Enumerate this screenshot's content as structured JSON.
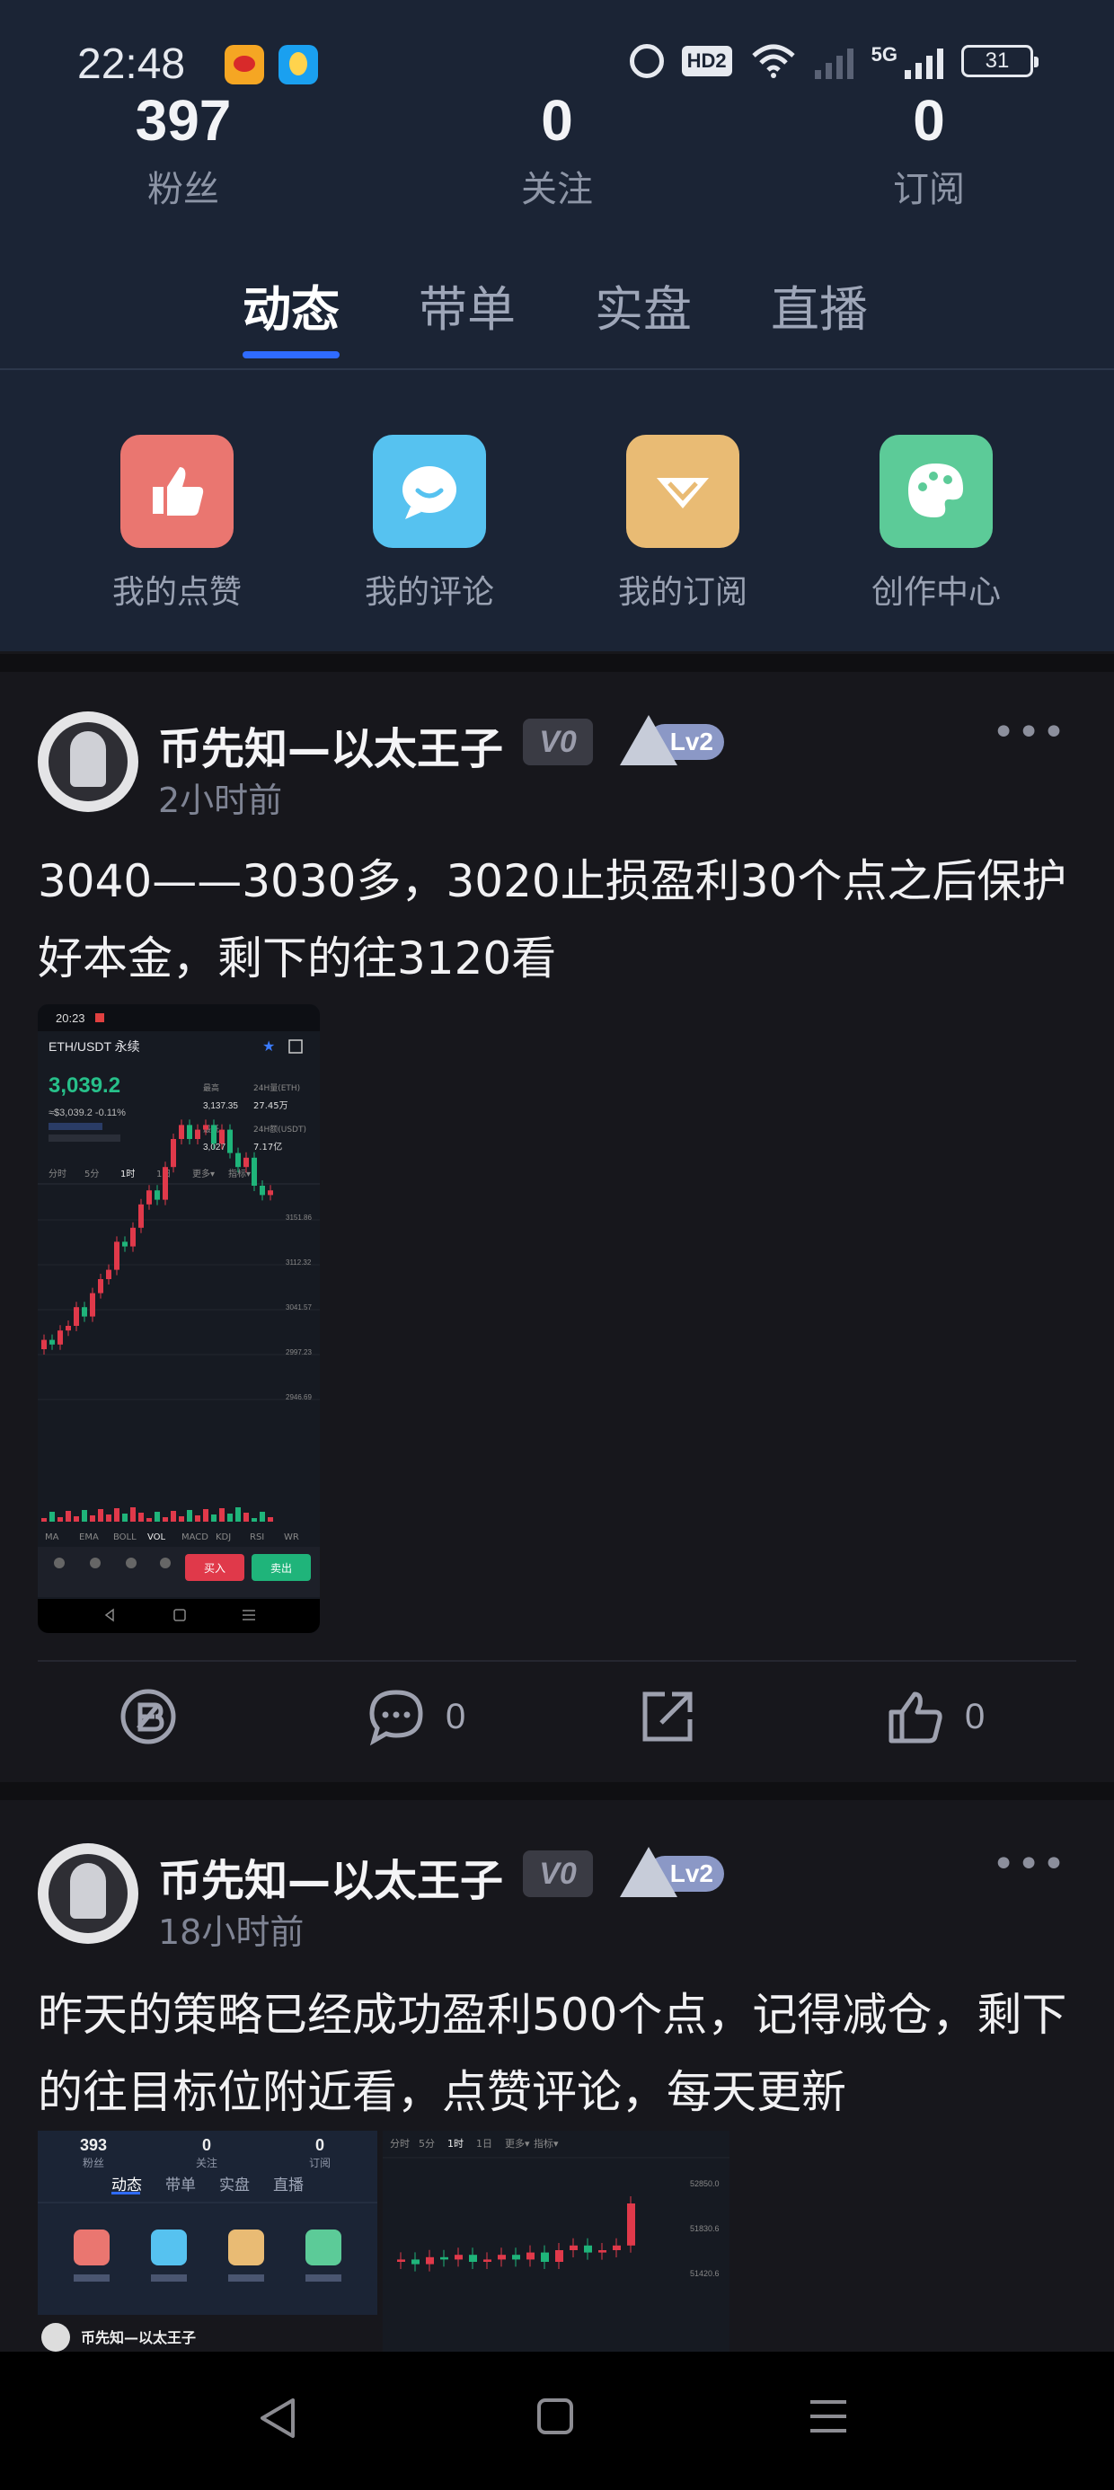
{
  "statusbar": {
    "time": "22:48",
    "hd": "HD2",
    "network": "5G",
    "battery": "31"
  },
  "stats": [
    {
      "num": "397",
      "label": "粉丝"
    },
    {
      "num": "0",
      "label": "关注"
    },
    {
      "num": "0",
      "label": "订阅"
    }
  ],
  "tabs": [
    "动态",
    "带单",
    "实盘",
    "直播"
  ],
  "shortcuts": [
    "我的点赞",
    "我的评论",
    "我的订阅",
    "创作中心"
  ],
  "posts": [
    {
      "author": "币先知—以太王子",
      "badge": "V0",
      "level": "Lv2",
      "time": "2小时前",
      "text": "3040——3030多，3020止损盈利30个点之后保护好本金，剩下的往3120看",
      "comments": "0",
      "likes": "0",
      "screenshot": {
        "time": "20:23",
        "pair": "ETH/USDT 永续",
        "price": "3,039.2",
        "change": "≈$3,039.2  -0.11%",
        "high_label": "最高",
        "high": "3,137.35",
        "low_label": "最低",
        "low": "3,027",
        "vol_label": "24H量(ETH)",
        "vol": "27.45万",
        "turnover_label": "24H额(USDT)",
        "turnover": "7.17亿",
        "timeframes": [
          "分时",
          "5分",
          "1时",
          "1日",
          "更多▾",
          "指标▾"
        ],
        "axis": [
          "3151.86",
          "3112.32",
          "3041.57",
          "2997.23",
          "2946.69"
        ],
        "indicators": [
          "MA",
          "EMA",
          "BOLL",
          "VOL",
          "MACD",
          "KDJ",
          "RSI",
          "WR"
        ],
        "buy": "买入",
        "sell": "卖出"
      }
    },
    {
      "author": "币先知—以太王子",
      "badge": "V0",
      "level": "Lv2",
      "time": "18小时前",
      "text": "昨天的策略已经成功盈利500个点，记得减仓，剩下的往目标位附近看，点赞评论，每天更新",
      "thumb": {
        "stats": [
          "393",
          "0",
          "0"
        ],
        "stat_labels": [
          "粉丝",
          "关注",
          "订阅"
        ],
        "tabs": [
          "动态",
          "带单",
          "实盘",
          "直播"
        ],
        "author": "币先知—以太王子",
        "timeframes": [
          "分时",
          "5分",
          "1时",
          "1日",
          "更多▾",
          "指标▾"
        ],
        "axis": [
          "52850.0",
          "51830.6",
          "51420.6"
        ]
      }
    }
  ]
}
